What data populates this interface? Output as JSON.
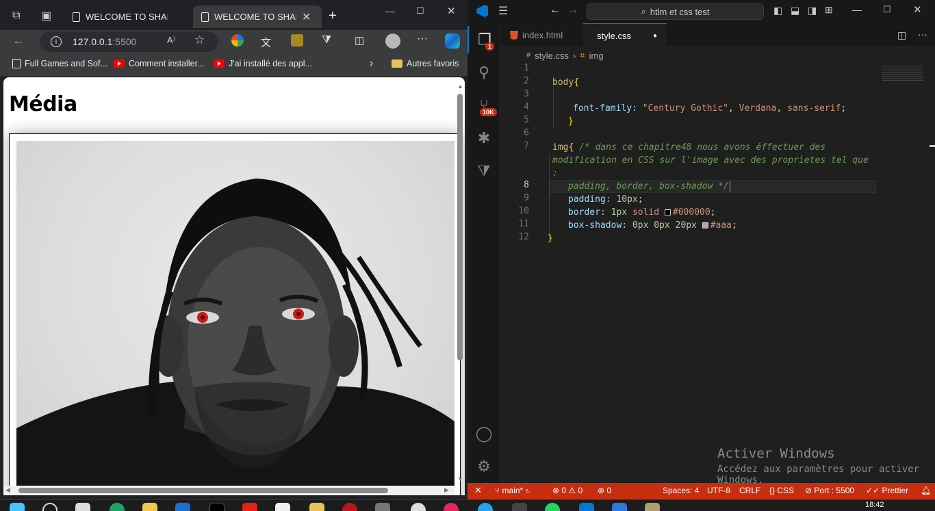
{
  "browser": {
    "tabs": [
      {
        "title": "WELCOME TO SHARING",
        "active": false
      },
      {
        "title": "WELCOME TO SHARING",
        "active": true
      }
    ],
    "address": {
      "host": "127.0.0.1",
      "port": ":5500"
    },
    "bookmarks": [
      {
        "label": "Full Games and Sof..."
      },
      {
        "label": "Comment installer..."
      },
      {
        "label": "J'ai installé des appl..."
      }
    ],
    "other_favorites": "Autres favoris",
    "page": {
      "heading": "Média"
    }
  },
  "vscode": {
    "search": "htlm et css test",
    "tabs": [
      {
        "name": "index.html",
        "active": false
      },
      {
        "name": "style.css",
        "active": true
      }
    ],
    "breadcrumb": {
      "file": "style.css",
      "symbol": "img"
    },
    "explorer_badge": "1",
    "scm_badge": "10K",
    "line_numbers": [
      "1",
      "2",
      "3",
      "4",
      "5",
      "6",
      "7",
      "",
      "",
      "8",
      "9",
      "10",
      "11",
      "12"
    ],
    "code": {
      "l2_sel": "body",
      "l4_prop": "font-family",
      "l4_str": "\"Century Gothic\"",
      "l4_v1": "Verdana",
      "l4_v2": "sans-serif",
      "l7_sel": "img",
      "l7_com": "/* dans ce chapitre48 nous avons éffectuer des",
      "l7b_com": "modification en CSS sur l'image avec des proprìetes tel que",
      "l7c_com": ":",
      "l8_com": "padding, border, box-shadow */",
      "l9_prop": "padding",
      "l9_num": "10px",
      "l10_prop": "border",
      "l10_num": "1px",
      "l10_val": "solid",
      "l10_color": "#000000",
      "l11_prop": "box-shadow",
      "l11_num": "0px 0px 20px",
      "l11_color": "#aaa"
    },
    "watermark": {
      "title": "Activer Windows",
      "subtitle": "Accédez aux paramètres pour activer Windows."
    },
    "status": {
      "branch": "main*",
      "problems_errors": "0",
      "problems_warnings": "0",
      "ports": "0",
      "spaces": "Spaces: 4",
      "encoding": "UTF-8",
      "eol": "CRLF",
      "language": "CSS",
      "port": "Port : 5500",
      "prettier": "Prettier"
    }
  },
  "taskbar": {
    "time": "18:42"
  },
  "colors": {
    "vscode_status": "#c72e0f",
    "accent_blue": "#0078d4"
  }
}
